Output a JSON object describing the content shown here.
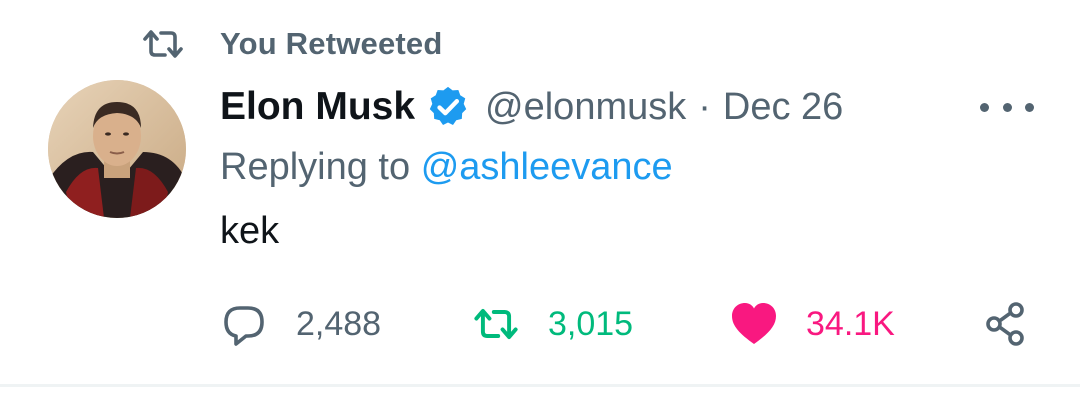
{
  "retweet_context": {
    "icon": "retweet-icon",
    "text": "You Retweeted"
  },
  "author": {
    "display_name": "Elon Musk",
    "verified_icon": "verified-badge-icon",
    "handle": "@elonmusk",
    "separator": "·",
    "date": "Dec 26"
  },
  "reply": {
    "prefix": "Replying to",
    "mention": "@ashleevance"
  },
  "tweet": {
    "text": "kek"
  },
  "actions": {
    "reply": {
      "icon": "reply-icon",
      "count": "2,488"
    },
    "retweet": {
      "icon": "retweet-icon",
      "count": "3,015",
      "active": true
    },
    "like": {
      "icon": "heart-icon",
      "count": "34.1K",
      "active": true
    },
    "share": {
      "icon": "share-icon"
    }
  },
  "colors": {
    "text_primary": "#0f1419",
    "text_secondary": "#536471",
    "link_blue": "#1d9bf0",
    "retweet_green": "#00ba7c",
    "like_pink": "#f91880",
    "divider": "#eff3f4"
  }
}
